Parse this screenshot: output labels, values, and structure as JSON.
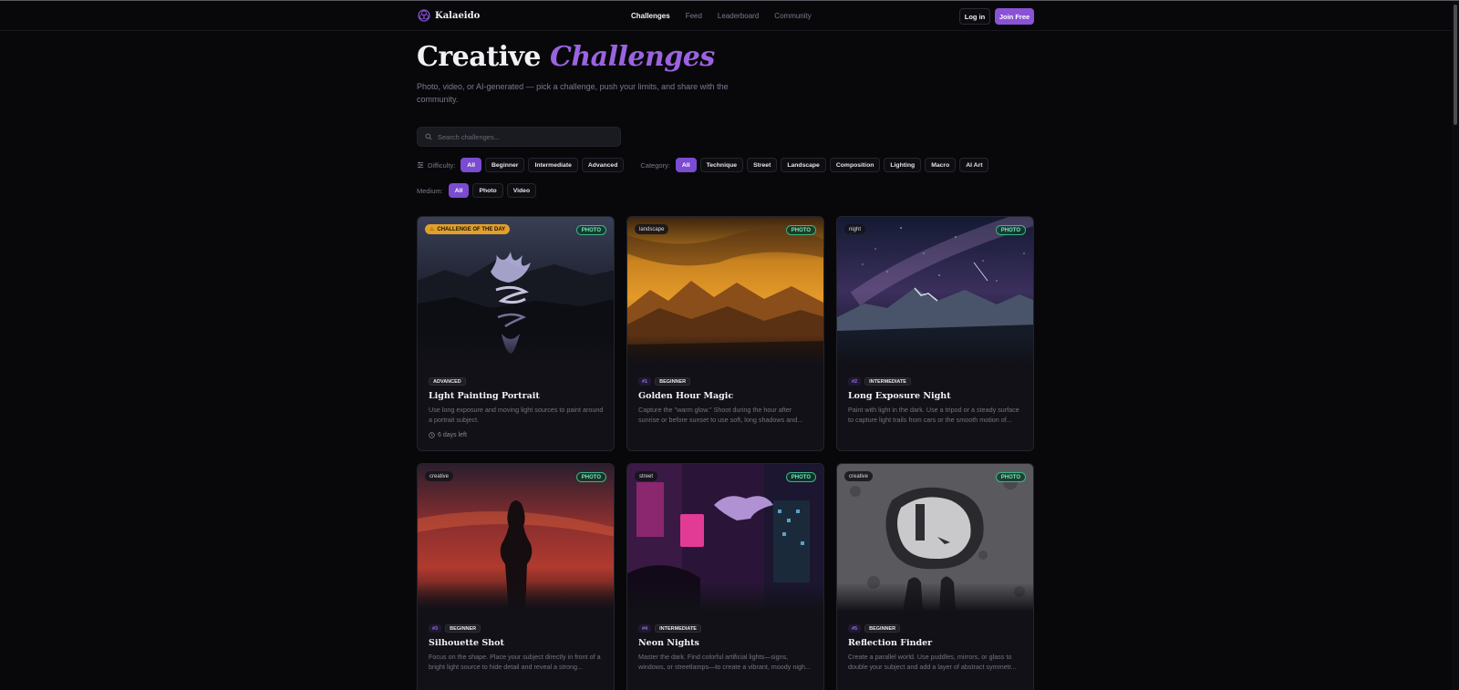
{
  "nav": {
    "brand": "Kalaeido",
    "links": [
      "Challenges",
      "Feed",
      "Leaderboard",
      "Community"
    ],
    "login": "Log in",
    "join": "Join Free"
  },
  "hero": {
    "title_plain": "Creative",
    "title_accent": "Challenges",
    "subtitle": "Photo, video, or AI-generated — pick a challenge, push your limits, and share with the community."
  },
  "search": {
    "placeholder": "Search challenges..."
  },
  "filters": {
    "difficulty": {
      "label": "Difficulty:",
      "options": [
        "All",
        "Beginner",
        "Intermediate",
        "Advanced"
      ],
      "selected": "All"
    },
    "category": {
      "label": "Category:",
      "options": [
        "All",
        "Technique",
        "Street",
        "Landscape",
        "Composition",
        "Lighting",
        "Macro",
        "AI Art"
      ],
      "selected": "All"
    },
    "medium": {
      "label": "Medium:",
      "options": [
        "All",
        "Photo",
        "Video"
      ],
      "selected": "All"
    }
  },
  "cards": [
    {
      "tag": "CHALLENGE OF THE DAY",
      "medium": "PHOTO",
      "number": "",
      "level": "ADVANCED",
      "title": "Light Painting Portrait",
      "desc": "Use long exposure and moving light sources to paint around a portrait subject.",
      "time": "6 days left"
    },
    {
      "tag": "landscape",
      "medium": "PHOTO",
      "number": "#1",
      "level": "BEGINNER",
      "title": "Golden Hour Magic",
      "desc": "Capture the \"warm glow.\" Shoot during the hour after sunrise or before sunset to use soft, long shadows and...",
      "time": ""
    },
    {
      "tag": "night",
      "medium": "PHOTO",
      "number": "#2",
      "level": "INTERMEDIATE",
      "title": "Long Exposure Night",
      "desc": "Paint with light in the dark. Use a tripod or a steady surface to capture light trails from cars or the smooth motion of...",
      "time": ""
    },
    {
      "tag": "creative",
      "medium": "PHOTO",
      "number": "#3",
      "level": "BEGINNER",
      "title": "Silhouette Shot",
      "desc": "Focus on the shape. Place your subject directly in front of a bright light source to hide detail and reveal a strong...",
      "time": ""
    },
    {
      "tag": "street",
      "medium": "PHOTO",
      "number": "#4",
      "level": "INTERMEDIATE",
      "title": "Neon Nights",
      "desc": "Master the dark. Find colorful artificial lights—signs, windows, or streetlamps—to create a vibrant, moody nigh...",
      "time": ""
    },
    {
      "tag": "creative",
      "medium": "PHOTO",
      "number": "#5",
      "level": "BEGINNER",
      "title": "Reflection Finder",
      "desc": "Create a parallel world. Use puddles, mirrors, or glass to double your subject and add a layer of abstract symmetr...",
      "time": ""
    }
  ],
  "colors": {
    "accent": "#8a52d6",
    "background": "#08080b",
    "card": "#111117",
    "photo_badge": "#3bb58a",
    "cotd": "#e2a02a"
  }
}
